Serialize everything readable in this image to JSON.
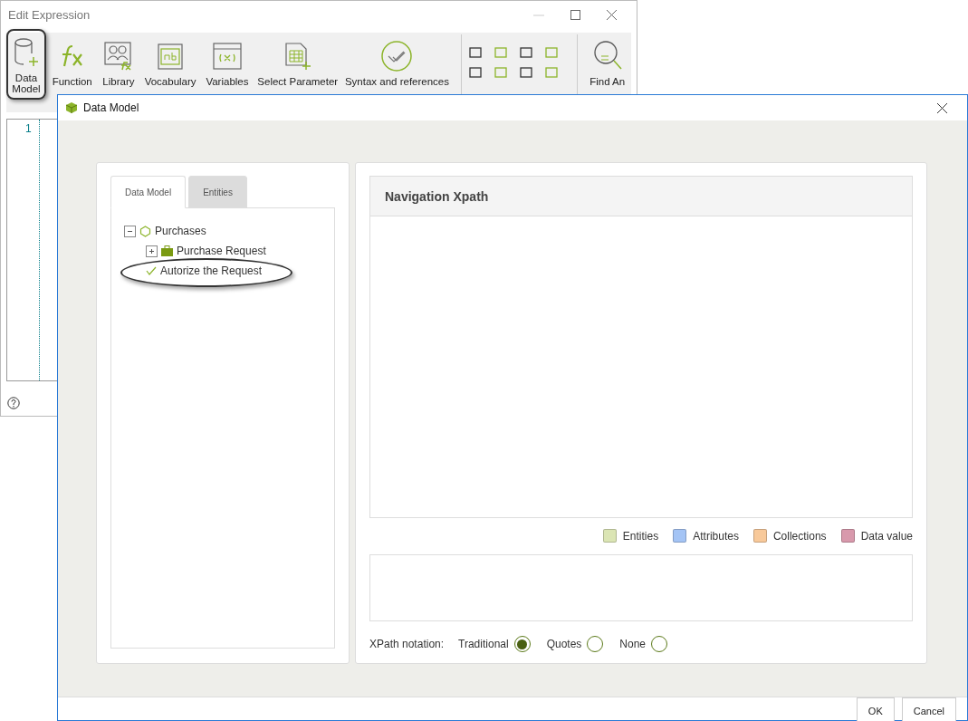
{
  "back_window": {
    "title": "Edit Expression",
    "toolbar": [
      {
        "kind": "data",
        "label": "Data",
        "label2": "Model",
        "highlighted": true
      },
      {
        "kind": "fx",
        "label": "Function",
        "highlighted": false
      },
      {
        "kind": "library",
        "label": "Library",
        "highlighted": false
      },
      {
        "kind": "vocab",
        "label": "Vocabulary",
        "highlighted": false
      },
      {
        "kind": "variables",
        "label": "Variables",
        "highlighted": false
      },
      {
        "kind": "param",
        "label": "Select Parameter",
        "highlighted": false
      },
      {
        "kind": "syntax",
        "label": "Syntax and references",
        "highlighted": false
      }
    ],
    "find_label": "Find An",
    "line_number": "1"
  },
  "dialog": {
    "title": "Data Model",
    "tabs": [
      {
        "label": "Data Model",
        "selected": true
      },
      {
        "label": "Entities",
        "selected": false
      }
    ],
    "tree": [
      {
        "label": "Purchases",
        "kind": "root",
        "expanded": true,
        "highlighted": false,
        "children": [
          {
            "label": "Purchase Request",
            "kind": "entity",
            "expanded": false,
            "highlighted": false
          },
          {
            "label": "Autorize the Request",
            "kind": "check",
            "highlighted": true
          }
        ]
      }
    ],
    "xpath_title": "Navigation Xpath",
    "legend": [
      {
        "label": "Entities",
        "color": "#dbe5b4"
      },
      {
        "label": "Attributes",
        "color": "#a4c4f5"
      },
      {
        "label": "Collections",
        "color": "#f8c99a"
      },
      {
        "label": "Data value",
        "color": "#d899ac"
      }
    ],
    "notation_label": "XPath notation:",
    "notation": [
      {
        "label": "Traditional",
        "selected": true
      },
      {
        "label": "Quotes",
        "selected": false
      },
      {
        "label": "None",
        "selected": false
      }
    ],
    "buttons": [
      "OK",
      "Cancel"
    ]
  }
}
